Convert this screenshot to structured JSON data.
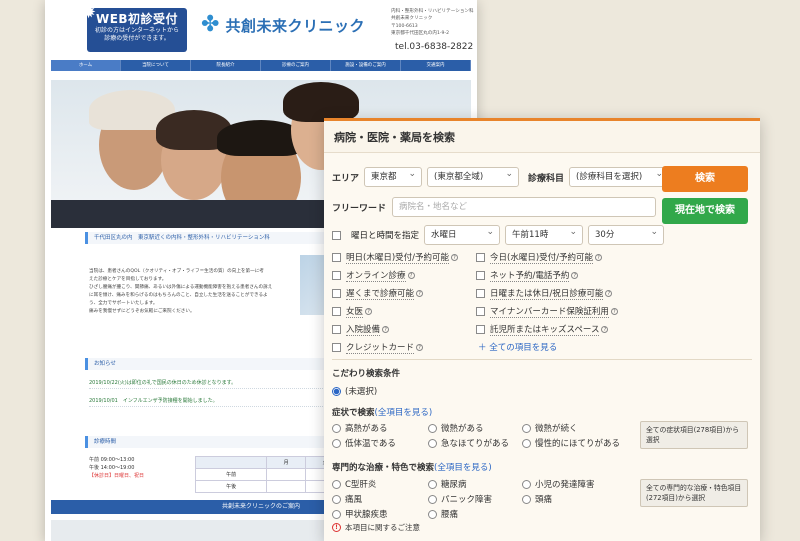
{
  "clinic": {
    "web_badge_title": "WEB初診受付",
    "web_badge_sub1": "初診の方はインターネットから",
    "web_badge_sub2": "診療の受付ができます。",
    "name": "共創未来クリニック",
    "addr1": "内科・整形外科・リハビリテーション科",
    "addr2": "共創未来クリニック",
    "addr3": "〒100-6613",
    "addr4": "東京都千代田区丸の内1-9-2",
    "tel": "tel.03-6838-2822",
    "nav": [
      "ホーム",
      "当院について",
      "院長紹介",
      "診療のご案内",
      "施設・設備のご案内",
      "交通案内"
    ],
    "section_intro": "千代田区丸の内　東京駅近くの内科・整形外科・リハビリテーション科",
    "intro_text1": "当院は、患者さんのQOL（クオリティ・オブ・ライフ＝生活の質）の向上を第一に考",
    "intro_text2": "えた診療とケアを目指しております。",
    "intro_text3": "ひざし腰痛が腫こり、関節痛、あるいは外傷による運動機能障害を抱える患者さんの訴え",
    "intro_text4": "に耳を傾け、痛みを和らげるのはもちろんのこと、自立した生活を送ることができるよ",
    "intro_text5": "う、全力でサポートいたします。",
    "intro_text6": "痛みを我慢せずにどうぞお気軽にご来院ください。",
    "section_news": "お知らせ",
    "news": [
      "2019/10/22(火)は即位の礼で国民の休日のため休診となります。",
      "2019/10/01　インフルエンザ予防接種を開始しました。"
    ],
    "section_hours": "診療時間",
    "hours_am": "午前 09:00～13:00",
    "hours_pm": "午後 14:00～19:00",
    "holiday": "【休診日】日曜日、祝日",
    "table_head": [
      "",
      "月",
      "火"
    ],
    "table_rows": [
      "午前",
      "午後"
    ],
    "guide_bar": "共創未来クリニックのご案内"
  },
  "panel": {
    "title": "病院・医院・薬局を検索",
    "area_label": "エリア",
    "pref": "東京都",
    "area": "(東京都全域)",
    "dept_label": "診療科目",
    "dept": "(診療科目を選択)",
    "search_button": "検索",
    "freeword_label": "フリーワード",
    "freeword_placeholder": "病院名・地名など",
    "here_button": "現在地で検索",
    "datetime_label": "曜日と時間を指定",
    "weekday": "水曜日",
    "time": "午前11時",
    "minutes": "30分",
    "options_left": [
      "明日(木曜日)受付/予約可能",
      "オンライン診療",
      "遅くまで診療可能",
      "女医",
      "入院設備",
      "クレジットカード"
    ],
    "options_right": [
      "今日(水曜日)受付/予約可能",
      "ネット予約/電話予約",
      "日曜または休日/祝日診療可能",
      "マイナンバーカード保険証利用",
      "託児所またはキッズスペース"
    ],
    "all_items_link": "＋ 全ての項目を見る",
    "kodawari_title": "こだわり検索条件",
    "unselected": "(未選択)",
    "symptom_title": "症状で検索",
    "symptom_link": "(全項目を見る)",
    "symptoms": [
      "高熱がある",
      "微熱がある",
      "微熱が続く",
      "低体温である",
      "急なほてりがある",
      "慢性的にほてりがある"
    ],
    "symptom_all_button": "全ての症状項目(278項目)から選択",
    "treatment_title": "専門的な治療・特色で検索",
    "treatment_link": "(全項目を見る)",
    "treatments": [
      "C型肝炎",
      "糖尿病",
      "小児の発達障害",
      "痛風",
      "パニック障害",
      "頭痛",
      "甲状腺疾患",
      "腰痛"
    ],
    "treatment_all_button": "全ての専門的な治療・特色項目(272項目)から選択",
    "notice": "本項目に関するご注意"
  }
}
